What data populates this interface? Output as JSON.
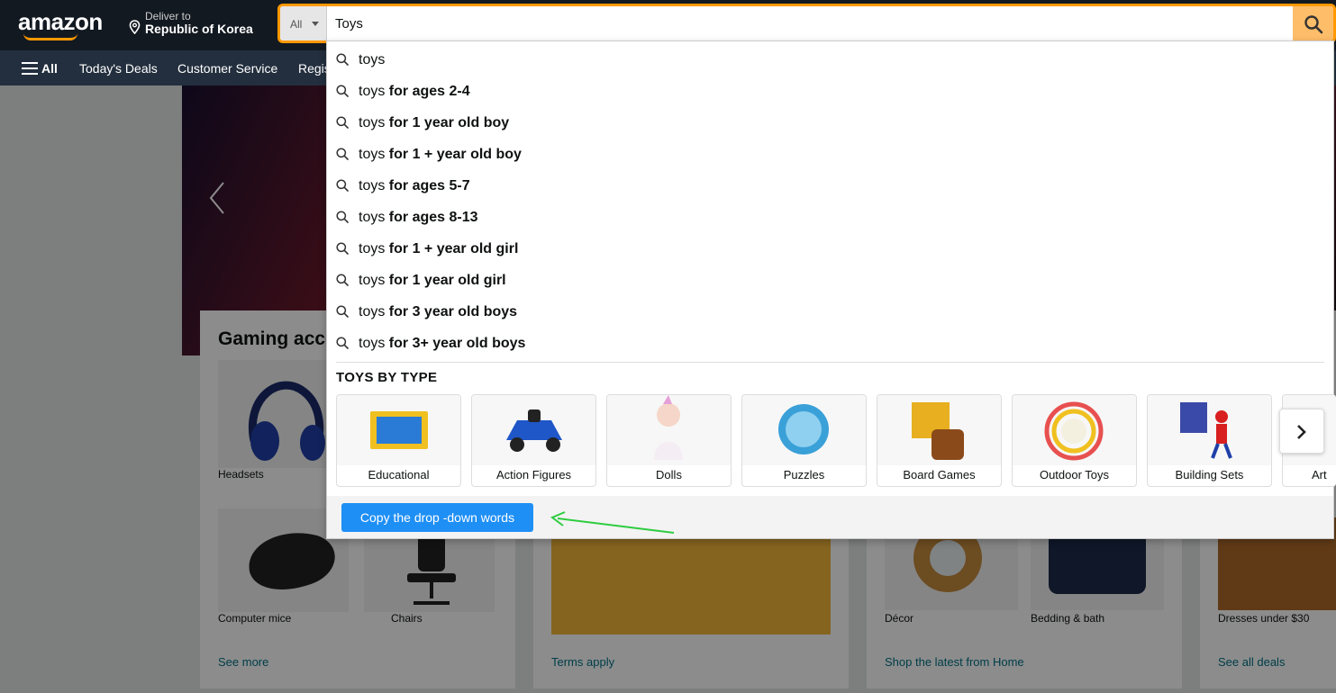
{
  "header": {
    "logo": "amazon",
    "deliver_line1": "Deliver to",
    "deliver_line2": "Republic of Korea",
    "search_category": "All",
    "search_value": "Toys"
  },
  "subnav": {
    "all": "All",
    "items": [
      "Today's Deals",
      "Customer Service",
      "Regis"
    ]
  },
  "cards": [
    {
      "title": "Gaming acce",
      "items": [
        "Headsets",
        "Computer mice",
        "Chairs"
      ],
      "link": "See more"
    },
    {
      "link": "Terms apply"
    },
    {
      "items": [
        "Décor",
        "Bedding & bath"
      ],
      "link": "Shop the latest from Home"
    },
    {
      "items": [
        "Dresses under $30"
      ],
      "link": "See all deals"
    }
  ],
  "suggestions": [
    {
      "prefix": "toys",
      "bold": ""
    },
    {
      "prefix": "toys ",
      "bold": "for ages 2-4"
    },
    {
      "prefix": "toys ",
      "bold": "for 1 year old boy"
    },
    {
      "prefix": "toys ",
      "bold": "for 1 + year old boy"
    },
    {
      "prefix": "toys ",
      "bold": "for ages 5-7"
    },
    {
      "prefix": "toys ",
      "bold": "for ages 8-13"
    },
    {
      "prefix": "toys ",
      "bold": "for 1 + year old girl"
    },
    {
      "prefix": "toys ",
      "bold": "for 1 year old girl"
    },
    {
      "prefix": "toys ",
      "bold": "for 3 year old boys"
    },
    {
      "prefix": "toys ",
      "bold": "for 3+ year old boys"
    }
  ],
  "toys_by_type": {
    "title": "TOYS BY TYPE",
    "tiles": [
      "Educational",
      "Action Figures",
      "Dolls",
      "Puzzles",
      "Board Games",
      "Outdoor Toys",
      "Building Sets",
      "Art"
    ]
  },
  "footer": {
    "copy_button": "Copy the drop -down words"
  },
  "colors": {
    "nav": "#131921",
    "subnav": "#232f3e",
    "accent": "#ff9900",
    "search_button": "#febd69",
    "copy_button": "#1e8ff5",
    "annotation_arrow": "#2ecc40"
  }
}
